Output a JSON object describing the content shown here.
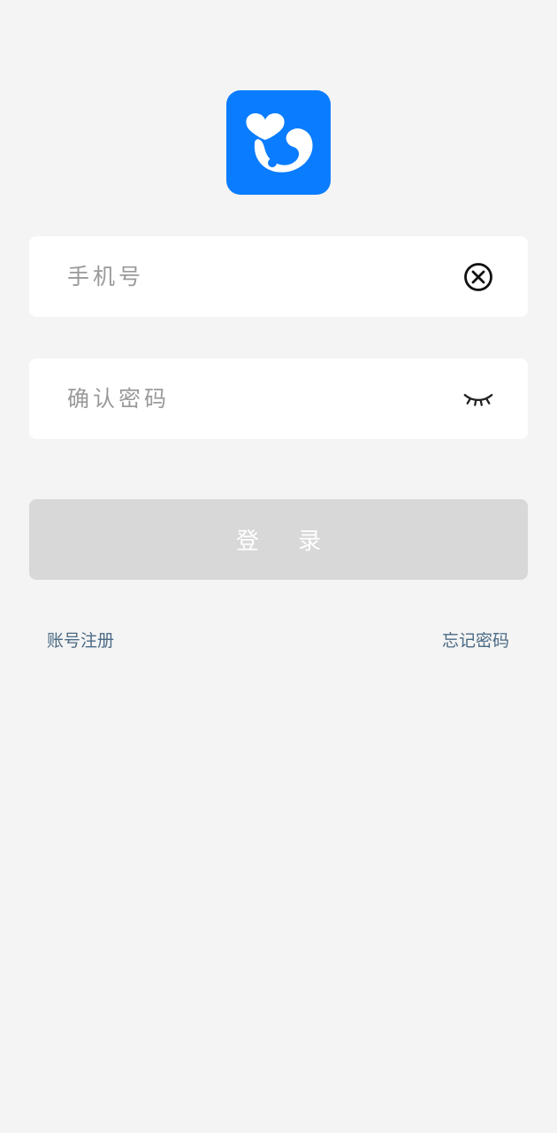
{
  "app": {
    "logo_icon": "app-logo-icon",
    "brand_color": "#0a7cff"
  },
  "phone_field": {
    "placeholder": "手机号",
    "value": "",
    "clear_icon": "clear-circle-x-icon"
  },
  "password_field": {
    "placeholder": "确认密码",
    "value": "",
    "toggle_icon": "eye-closed-icon"
  },
  "login_button": {
    "label": "登 录",
    "state": "disabled",
    "color": "#d8d8d8"
  },
  "links": {
    "register": "账号注册",
    "forgot_password": "忘记密码"
  }
}
